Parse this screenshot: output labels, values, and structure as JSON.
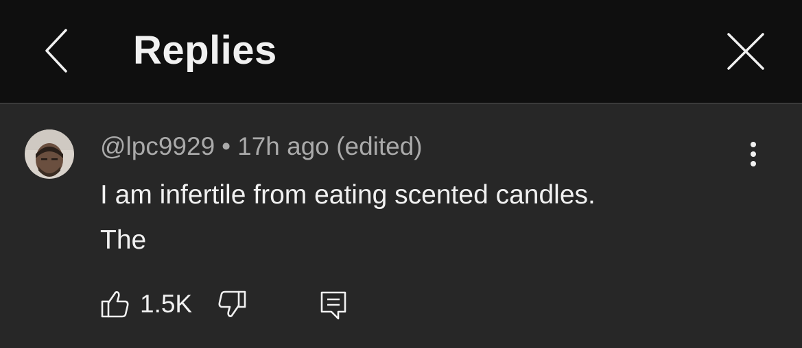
{
  "header": {
    "title": "Replies",
    "back_icon": "chevron-left-icon",
    "close_icon": "close-icon"
  },
  "comment": {
    "author": "@lpc9929",
    "separator": "•",
    "time": "17h ago",
    "edited": "(edited)",
    "text_line1": "I am infertile from eating scented candles.",
    "text_line2": "The",
    "likes": "1.5K",
    "more_icon": "more-vertical-icon",
    "like_icon": "thumbs-up-icon",
    "dislike_icon": "thumbs-down-icon",
    "reply_icon": "reply-icon"
  },
  "colors": {
    "header_bg": "#0f0f0f",
    "content_bg": "#272727",
    "primary_text": "#f1f1f1",
    "secondary_text": "#aaaaaa"
  }
}
